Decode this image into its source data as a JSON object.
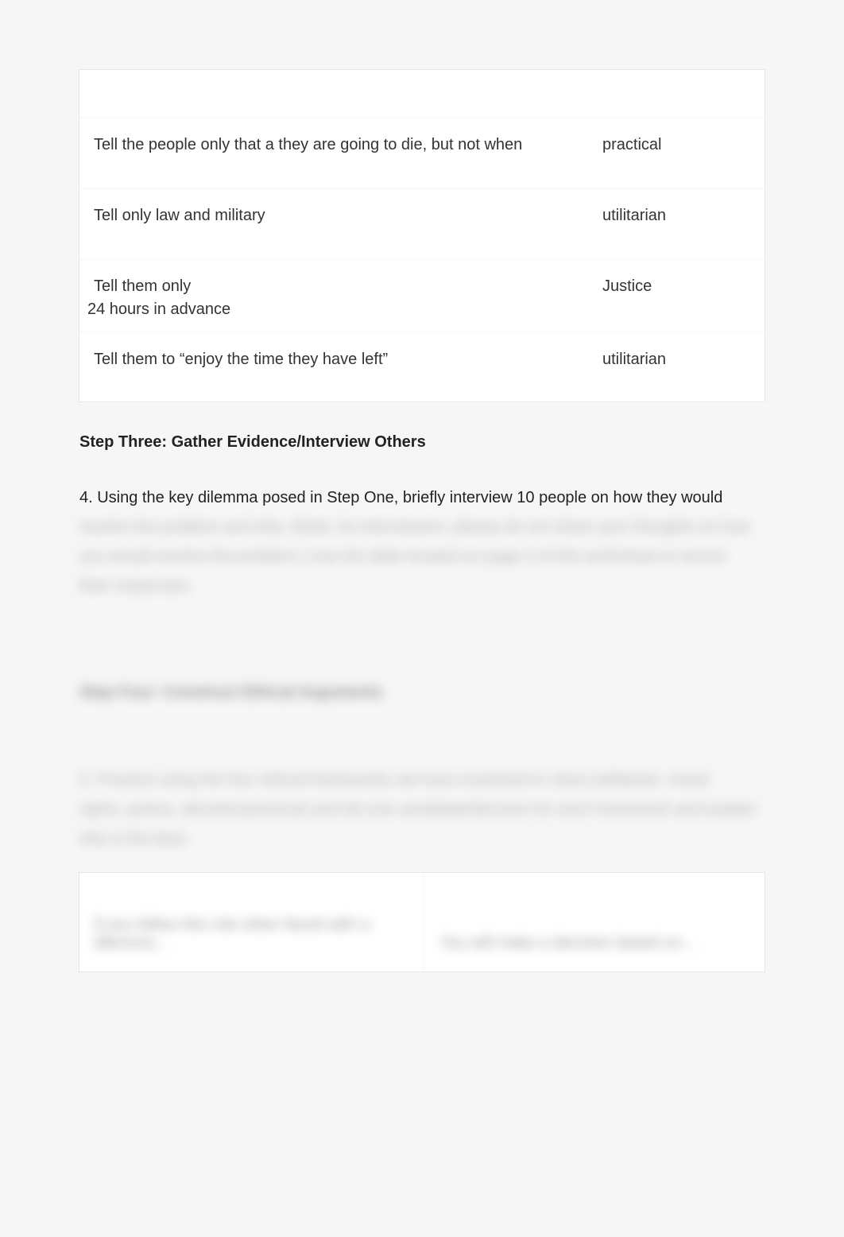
{
  "table1": {
    "rows": [
      {
        "left": "Tell the people only that a they are going to die, but not when",
        "right": "practical"
      },
      {
        "left": "Tell only law and military",
        "right": "utilitarian"
      },
      {
        "left_line1": "Tell them only",
        "left_line2": "24 hours in advance",
        "right": "Justice",
        "two_line": true
      },
      {
        "left": "Tell them to “enjoy the time they have left”",
        "right": "utilitarian"
      }
    ]
  },
  "step_three_heading": "Step Three: Gather Evidence/Interview Others",
  "q4_visible": "4. Using the key dilemma posed in Step One, briefly interview 10 people on how they would",
  "q4_blur_1": "resolve the problem and why.  (Note: As interviewers, please do not share your thoughts on how",
  "q4_blur_2": "you would resolve the problem.)  Use the table located on page 4 of this worksheet to record",
  "q4_blur_3": "their responses.",
  "step_four_heading": "Step Four: Construct Ethical Arguments",
  "q5_blur_1": "5. Practice using the four ethical frameworks we have examined in class (utilitarian,  moral",
  "q5_blur_2": "rights, justice, altruistic/practical) and list one candidate/decision for each framework and explain",
  "q5_blur_3": "why is the best.",
  "table2": {
    "left_line1": "If you follow this rule when faced with a",
    "left_line2": "dilemma…",
    "right": "You will make a decision based on…"
  }
}
